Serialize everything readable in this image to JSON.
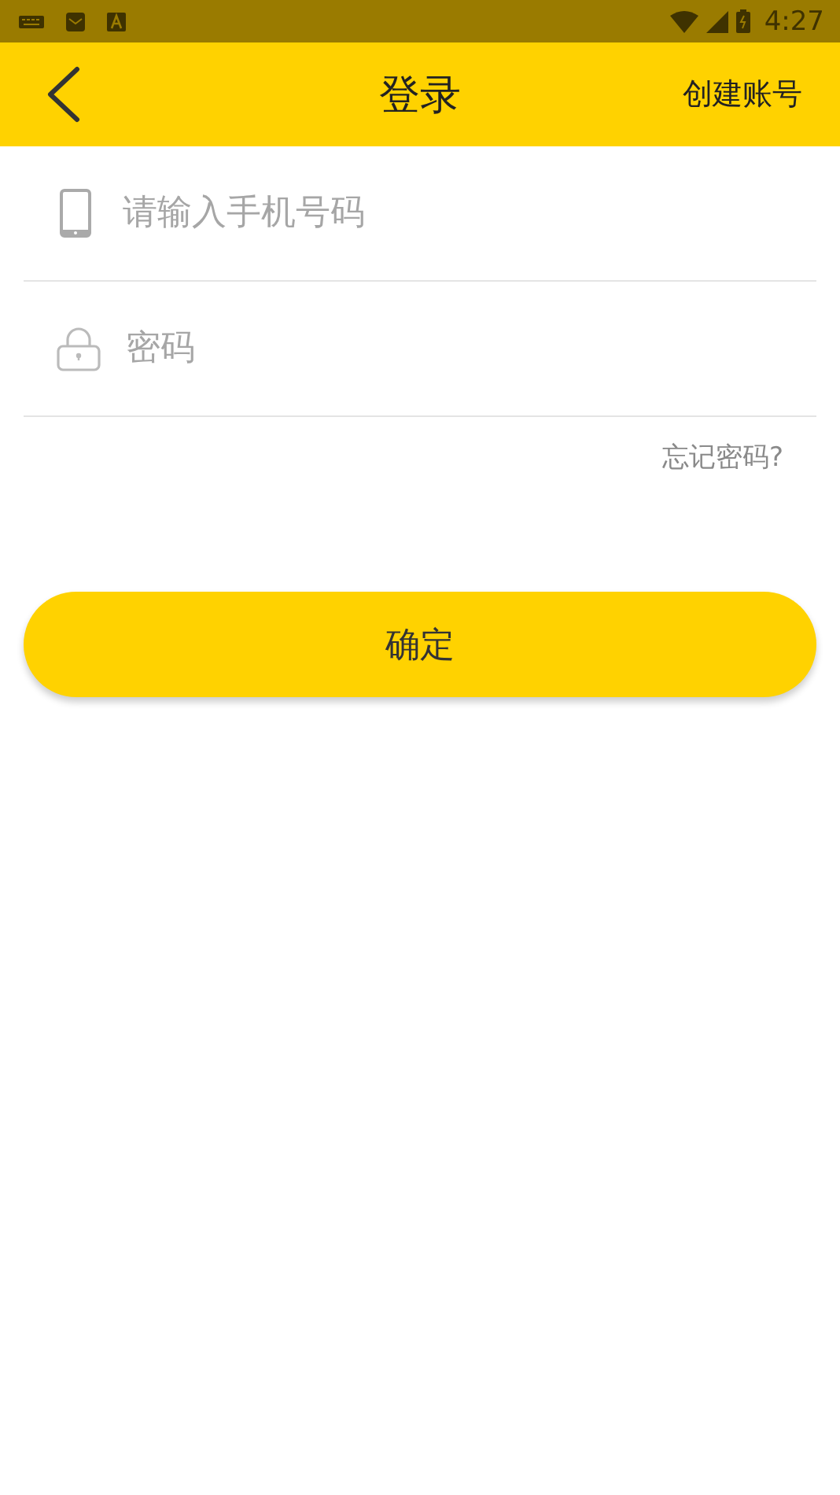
{
  "status_bar": {
    "time": "4:27"
  },
  "header": {
    "title": "登录",
    "action": "创建账号"
  },
  "fields": [
    {
      "kind": "phone",
      "placeholder": "请输入手机号码"
    },
    {
      "kind": "password",
      "placeholder": "密码"
    }
  ],
  "forgot_link": "忘记密码?",
  "submit_button": "确定"
}
